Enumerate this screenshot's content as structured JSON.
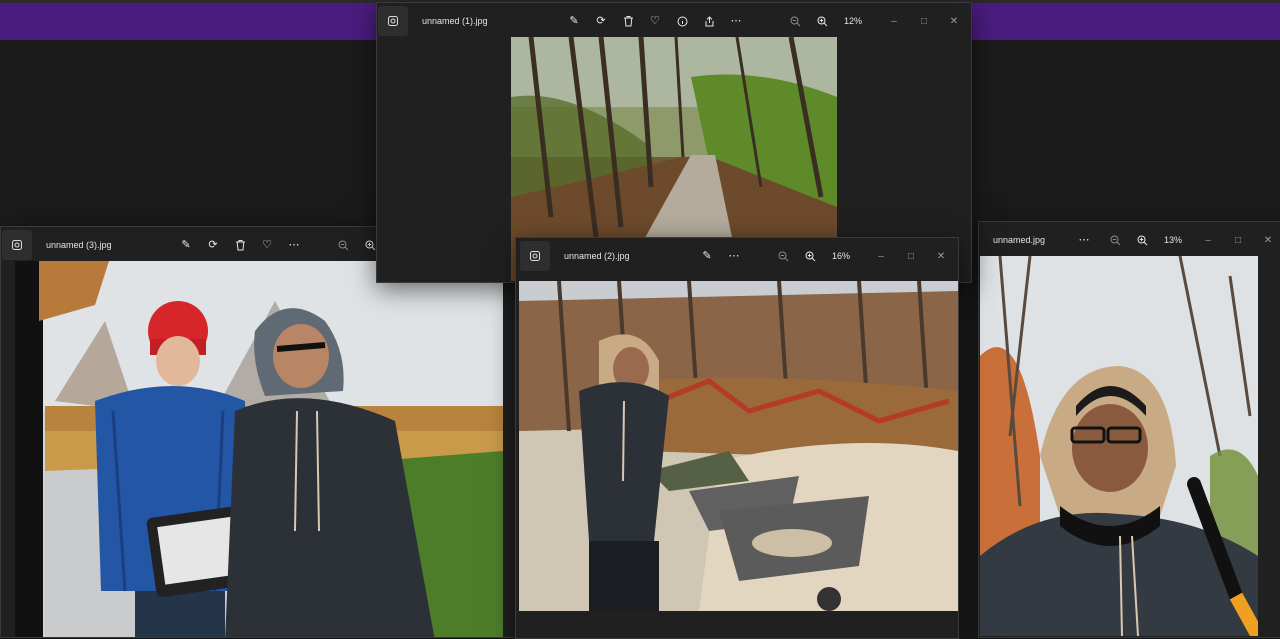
{
  "windows": [
    {
      "id": "photo-viewer-1",
      "title": "unnamed (1).jpg",
      "zoom": "12%",
      "photo": "forest trail"
    },
    {
      "id": "photo-viewer-3",
      "title": "unnamed (3).jpg",
      "photo": "two boys in park"
    },
    {
      "id": "photo-viewer-2",
      "title": "unnamed (2).jpg",
      "zoom": "16%",
      "photo": "boy with wheelbarrows"
    },
    {
      "id": "photo-viewer-0",
      "title": "unnamed.jpg",
      "zoom": "13%",
      "photo": "boy in hood selfie"
    }
  ],
  "icons": {
    "app": "photos-app-icon",
    "edit": "edit-image-icon",
    "rotate": "rotate-icon",
    "delete": "trash-icon",
    "favorite": "heart-icon",
    "info": "info-icon",
    "share": "share-icon",
    "more": "more-icon",
    "zoom_out": "zoom-out-icon",
    "zoom_in": "zoom-in-icon",
    "minimize": "minimize-icon",
    "maximize": "maximize-icon",
    "close": "close-icon"
  },
  "colors": {
    "accent_band": "#4b1c80",
    "window_bg": "#202020",
    "desktop": "#1b1b1b"
  }
}
